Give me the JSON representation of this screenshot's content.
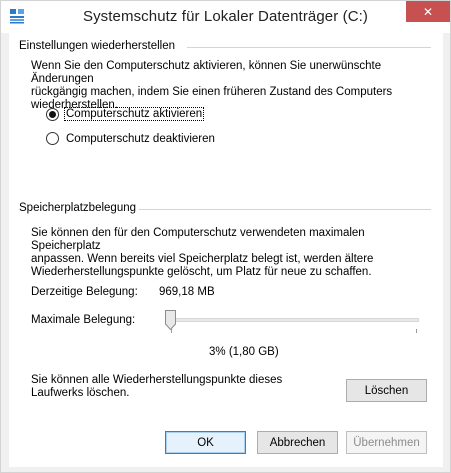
{
  "window": {
    "title": "Systemschutz für Lokaler Datenträger (C:)",
    "close_glyph": "✕",
    "app_icon": "system-protection-icon",
    "close_color": "#c75050"
  },
  "restore_section": {
    "heading": "Einstellungen wiederherstellen",
    "description_lines": [
      "Wenn Sie den Computerschutz aktivieren, können Sie unerwünschte Änderungen",
      "rückgängig machen, indem Sie einen früheren Zustand des Computers",
      "wiederherstellen."
    ],
    "options": [
      {
        "label": "Computerschutz aktivieren",
        "selected": true
      },
      {
        "label": "Computerschutz deaktivieren",
        "selected": false
      }
    ]
  },
  "storage_section": {
    "heading": "Speicherplatzbelegung",
    "description_lines": [
      "Sie können den für den Computerschutz verwendeten maximalen Speicherplatz",
      "anpassen. Wenn bereits viel Speicherplatz belegt ist, werden ältere",
      "Wiederherstellungspunkte gelöscht, um Platz für neue zu schaffen."
    ],
    "current_usage_label": "Derzeitige Belegung:",
    "current_usage_value": "969,18 MB",
    "max_usage_label": "Maximale Belegung:",
    "max_usage_percent": 3,
    "max_usage_readout": "3% (1,80 GB)",
    "delete_text_lines": [
      "Sie können alle Wiederherstellungspunkte dieses",
      "Laufwerks löschen."
    ],
    "delete_button": "Löschen"
  },
  "footer": {
    "ok_label": "OK",
    "cancel_label": "Abbrechen",
    "apply_label": "Übernehmen"
  }
}
